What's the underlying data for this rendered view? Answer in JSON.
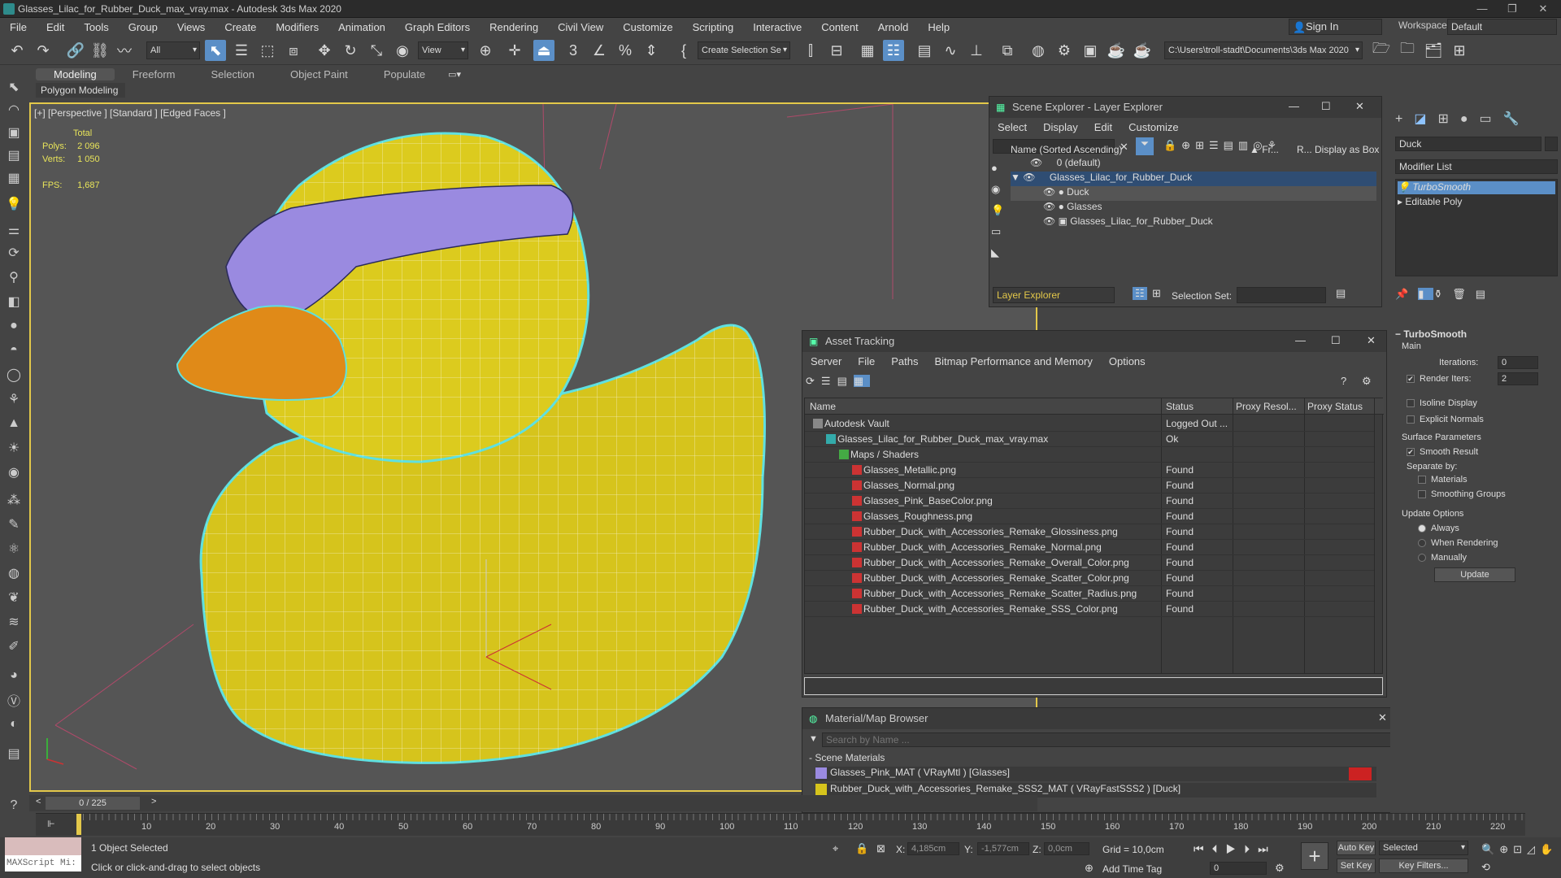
{
  "app": {
    "title": "Glasses_Lilac_for_Rubber_Duck_max_vray.max - Autodesk 3ds Max 2020"
  },
  "menu": [
    "File",
    "Edit",
    "Tools",
    "Group",
    "Views",
    "Create",
    "Modifiers",
    "Animation",
    "Graph Editors",
    "Rendering",
    "Civil View",
    "Customize",
    "Scripting",
    "Interactive",
    "Content",
    "Arnold",
    "Help"
  ],
  "account": {
    "sign_in": "Sign In",
    "workspaces_label": "Workspaces:",
    "workspace": "Default"
  },
  "toolbar": {
    "filter": "All",
    "view": "View",
    "selection_set": "Create Selection Se",
    "path": "C:\\Users\\troll-stadt\\Documents\\3ds Max 2020"
  },
  "ribbon": {
    "tabs": [
      "Modeling",
      "Freeform",
      "Selection",
      "Object Paint",
      "Populate"
    ],
    "sub": "Polygon Modeling"
  },
  "viewport": {
    "label": "[+] [Perspective ] [Standard ] [Edged Faces ]",
    "total_label": "Total",
    "polys_label": "Polys:",
    "polys": "2 096",
    "verts_label": "Verts:",
    "verts": "1 050",
    "fps_label": "FPS:",
    "fps": "1,687"
  },
  "scene_explorer": {
    "title": "Scene Explorer - Layer Explorer",
    "menu": [
      "Select",
      "Display",
      "Edit",
      "Customize"
    ],
    "col_name": "Name (Sorted Ascending)",
    "col_fr": "▲ Fr...",
    "col_r": "R...",
    "col_box": "Display as Box",
    "rows": [
      "0 (default)",
      "Glasses_Lilac_for_Rubber_Duck",
      "Duck",
      "Glasses",
      "Glasses_Lilac_for_Rubber_Duck"
    ],
    "footer": "Layer Explorer",
    "selection_set": "Selection Set:"
  },
  "asset_tracking": {
    "title": "Asset Tracking",
    "menu": [
      "Server",
      "File",
      "Paths",
      "Bitmap Performance and Memory",
      "Options"
    ],
    "cols": [
      "Name",
      "Status",
      "Proxy Resol...",
      "Proxy Status"
    ],
    "rows": [
      {
        "name": "Autodesk Vault",
        "status": "Logged Out ..."
      },
      {
        "name": "Glasses_Lilac_for_Rubber_Duck_max_vray.max",
        "status": "Ok"
      },
      {
        "name": "Maps / Shaders",
        "status": ""
      },
      {
        "name": "Glasses_Metallic.png",
        "status": "Found"
      },
      {
        "name": "Glasses_Normal.png",
        "status": "Found"
      },
      {
        "name": "Glasses_Pink_BaseColor.png",
        "status": "Found"
      },
      {
        "name": "Glasses_Roughness.png",
        "status": "Found"
      },
      {
        "name": "Rubber_Duck_with_Accessories_Remake_Glossiness.png",
        "status": "Found"
      },
      {
        "name": "Rubber_Duck_with_Accessories_Remake_Normal.png",
        "status": "Found"
      },
      {
        "name": "Rubber_Duck_with_Accessories_Remake_Overall_Color.png",
        "status": "Found"
      },
      {
        "name": "Rubber_Duck_with_Accessories_Remake_Scatter_Color.png",
        "status": "Found"
      },
      {
        "name": "Rubber_Duck_with_Accessories_Remake_Scatter_Radius.png",
        "status": "Found"
      },
      {
        "name": "Rubber_Duck_with_Accessories_Remake_SSS_Color.png",
        "status": "Found"
      }
    ]
  },
  "material_browser": {
    "title": "Material/Map Browser",
    "search": "Search by Name ...",
    "section": "- Scene Materials",
    "items": [
      "Glasses_Pink_MAT  ( VRayMtl ) [Glasses]",
      "Rubber_Duck_with_Accessories_Remake_SSS2_MAT  ( VRayFastSSS2 ) [Duck]"
    ]
  },
  "command_panel": {
    "object_name": "Duck",
    "modifier_list": "Modifier List",
    "stack": [
      "TurboSmooth",
      "Editable Poly"
    ],
    "rollout": "TurboSmooth",
    "main": "Main",
    "iterations_label": "Iterations:",
    "iterations": "0",
    "render_iters_label": "Render Iters:",
    "render_iters": "2",
    "isoline": "Isoline Display",
    "explicit": "Explicit Normals",
    "surface": "Surface Parameters",
    "smooth": "Smooth Result",
    "separate": "Separate by:",
    "materials": "Materials",
    "smoothing": "Smoothing Groups",
    "update_opts": "Update Options",
    "always": "Always",
    "when_render": "When Rendering",
    "manually": "Manually",
    "update": "Update"
  },
  "timeline": {
    "frame": "0 / 225",
    "ticks": [
      "10",
      "20",
      "30",
      "40",
      "50",
      "60",
      "70",
      "80",
      "90",
      "100",
      "110",
      "120",
      "130",
      "140",
      "150",
      "160",
      "170",
      "180",
      "190",
      "200",
      "210",
      "220"
    ]
  },
  "status": {
    "selected": "1 Object Selected",
    "hint": "Click or click-and-drag to select objects",
    "maxscript": "MAXScript Mi:",
    "x_label": "X:",
    "x": "4,185cm",
    "y_label": "Y:",
    "y": "-1,577cm",
    "z_label": "Z:",
    "z": "0,0cm",
    "grid": "Grid = 10,0cm",
    "add_time_tag": "Add Time Tag",
    "auto_key": "Auto Key",
    "selected_dd": "Selected",
    "set_key": "Set Key",
    "key_filters": "Key Filters...",
    "frame_num": "0"
  }
}
